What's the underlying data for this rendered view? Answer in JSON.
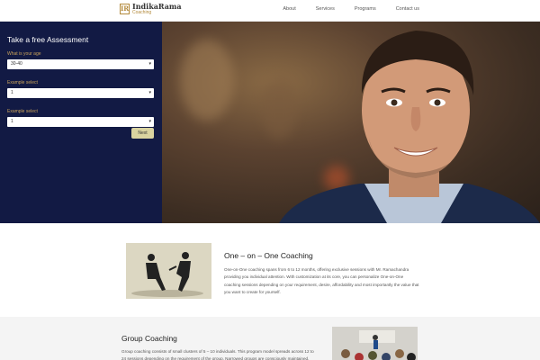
{
  "header": {
    "logo_mark": "IR",
    "logo_name": "IndikaRama",
    "logo_sub": "Coaching",
    "nav": [
      "About",
      "Services",
      "Programs",
      "Contact us"
    ]
  },
  "assessment": {
    "title": "Take a free Assessment",
    "age_label": "What is your age",
    "age_value": "30-40",
    "select2_label": "Example select",
    "select2_value": "1",
    "select3_label": "Example select",
    "select3_value": "1",
    "next_label": "Next"
  },
  "one_on_one": {
    "title": "One – on – One Coaching",
    "text": "One-on-One coaching spans from 6 to 12 months, offering exclusive sessions with Mr. Ramachandra providing you individual attention. With customization at its core, you can personalize One-on-One coaching sessions depending on your requirement, desire, affordability and most importantly the value that you want to create for yourself."
  },
  "group": {
    "title": "Group Coaching",
    "text": "Group coaching consists of small clusters of 5 – 10 individuals. This program model spreads across 12 to 24 sessions depending on the requirement of the group. Narrowed groups are consciously maintained."
  },
  "colors": {
    "panel": "#121a44",
    "accent": "#c9a25a",
    "button": "#d9d3a0"
  }
}
